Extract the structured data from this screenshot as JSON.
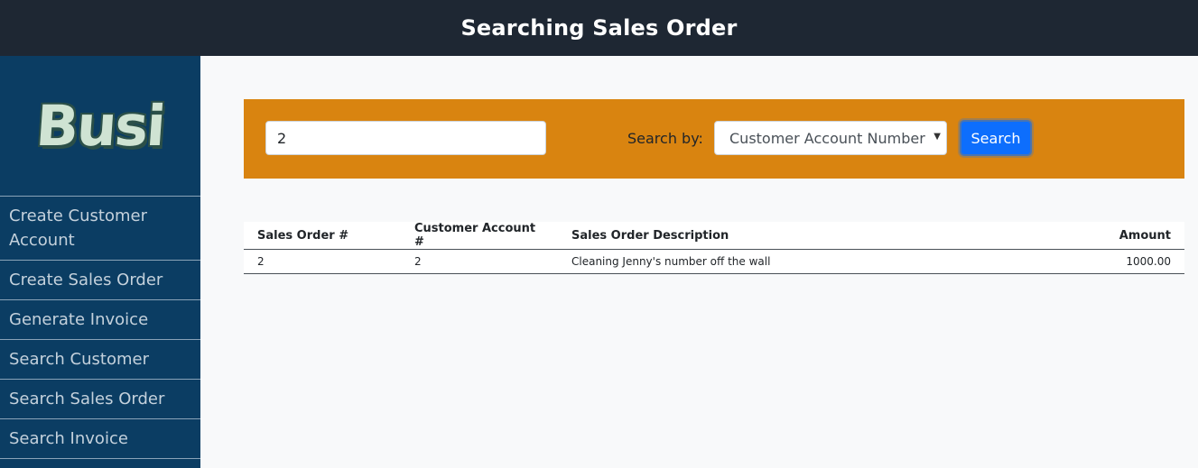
{
  "header": {
    "title": "Searching Sales Order"
  },
  "sidebar": {
    "logo_text": "Busi",
    "items": [
      {
        "label": "Create Customer Account"
      },
      {
        "label": "Create Sales Order"
      },
      {
        "label": "Generate Invoice"
      },
      {
        "label": "Search Customer"
      },
      {
        "label": "Search Sales Order"
      },
      {
        "label": "Search Invoice"
      }
    ]
  },
  "search": {
    "query_value": "2",
    "search_by_label": "Search by:",
    "search_by_selected": "Customer Account Number",
    "button_label": "Search"
  },
  "table": {
    "columns": [
      "Sales Order #",
      "Customer Account #",
      "Sales Order Description",
      "Amount"
    ],
    "rows": [
      [
        "2",
        "2",
        "Cleaning Jenny's number off the wall",
        "1000.00"
      ]
    ]
  },
  "colors": {
    "topbar": "#1e2733",
    "sidebar": "#0b3d63",
    "search_panel": "#d98410",
    "primary_button": "#0d6efd"
  }
}
